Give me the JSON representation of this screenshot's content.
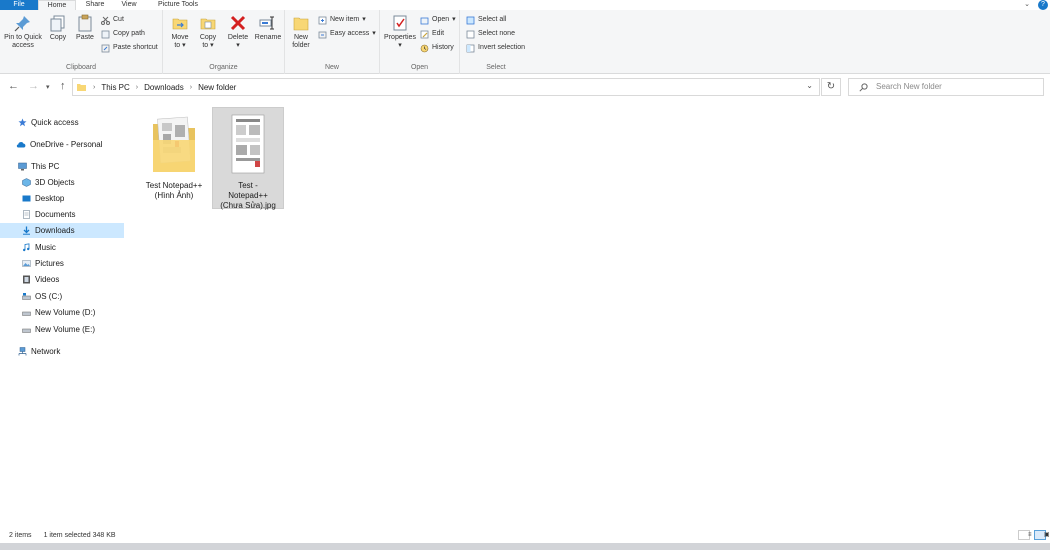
{
  "tabs": {
    "file": "File",
    "home": "Home",
    "share": "Share",
    "view": "View",
    "picture_tools": "Picture Tools"
  },
  "ribbon": {
    "clipboard": {
      "label": "Clipboard",
      "pin_to_quick_access_l1": "Pin to Quick",
      "pin_to_quick_access_l2": "access",
      "copy": "Copy",
      "paste": "Paste",
      "cut": "Cut",
      "copy_path": "Copy path",
      "paste_shortcut": "Paste shortcut"
    },
    "organize": {
      "label": "Organize",
      "move_to_l1": "Move",
      "move_to_l2": "to",
      "copy_to_l1": "Copy",
      "copy_to_l2": "to",
      "delete": "Delete",
      "rename": "Rename"
    },
    "new": {
      "label": "New",
      "new_folder_l1": "New",
      "new_folder_l2": "folder",
      "new_item": "New item",
      "easy_access": "Easy access"
    },
    "open": {
      "label": "Open",
      "properties": "Properties",
      "open": "Open",
      "edit": "Edit",
      "history": "History"
    },
    "select": {
      "label": "Select",
      "select_all": "Select all",
      "select_none": "Select none",
      "invert_selection": "Invert selection"
    }
  },
  "address": {
    "crumbs": [
      "This PC",
      "Downloads",
      "New folder"
    ],
    "search_placeholder": "Search New folder"
  },
  "sidebar": {
    "items": [
      {
        "label": "Quick access",
        "icon": "star-icon"
      },
      {
        "label": "OneDrive - Personal",
        "icon": "cloud-icon"
      },
      {
        "label": "This PC",
        "icon": "computer-icon"
      },
      {
        "label": "3D Objects",
        "icon": "cube-icon"
      },
      {
        "label": "Desktop",
        "icon": "desktop-icon"
      },
      {
        "label": "Documents",
        "icon": "document-icon"
      },
      {
        "label": "Downloads",
        "icon": "download-icon"
      },
      {
        "label": "Music",
        "icon": "music-icon"
      },
      {
        "label": "Pictures",
        "icon": "picture-icon"
      },
      {
        "label": "Videos",
        "icon": "video-icon"
      },
      {
        "label": "OS (C:)",
        "icon": "drive-icon"
      },
      {
        "label": "New Volume (D:)",
        "icon": "drive-icon"
      },
      {
        "label": "New Volume (E:)",
        "icon": "drive-icon"
      },
      {
        "label": "Network",
        "icon": "network-icon"
      }
    ]
  },
  "files": [
    {
      "name_l1": "Test Notepad++",
      "name_l2": "(Hình Ảnh)",
      "name_l3": "",
      "type": "folder"
    },
    {
      "name_l1": "Test -",
      "name_l2": "Notepad++",
      "name_l3": "(Chưa Sửa).jpg",
      "type": "image"
    }
  ],
  "status": {
    "item_count": "2 items",
    "selection": "1 item selected  348 KB"
  },
  "colors": {
    "accent": "#1979ca",
    "selected_sidebar": "#cce8ff",
    "selected_tile": "#d9d9d9",
    "folder_yellow": "#f8d775"
  }
}
